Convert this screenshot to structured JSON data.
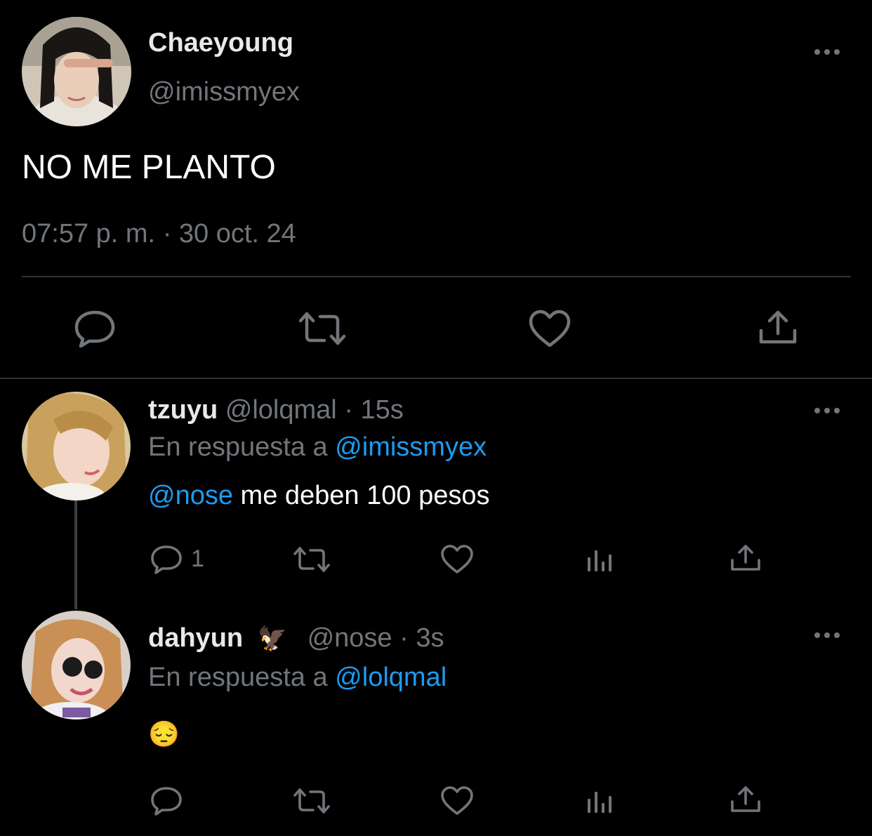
{
  "main_tweet": {
    "display_name": "Chaeyoung",
    "handle": "@imissmyex",
    "text": "NO ME PLANTO",
    "time": "07:57 p. m.",
    "separator": "·",
    "date": "30 oct. 24"
  },
  "replies": [
    {
      "display_name": "tzuyu",
      "handle": "@lolqmal",
      "separator": "·",
      "age": "15s",
      "reply_prefix": "En respuesta a",
      "reply_to": "@imissmyex",
      "mention": "@nose",
      "text": " me deben 100 pesos",
      "reply_count": "1"
    },
    {
      "display_name": "dahyun",
      "name_emoji": "🦅",
      "handle": "@nose",
      "separator": "·",
      "age": "3s",
      "reply_prefix": "En respuesta a",
      "reply_to": "@lolqmal",
      "text": "😔"
    }
  ],
  "icons": [
    "reply-icon",
    "retweet-icon",
    "like-icon",
    "views-icon",
    "share-icon",
    "more-icon"
  ],
  "colors": {
    "background": "#000000",
    "primary_text": "#e7e9ea",
    "secondary_text": "#71767b",
    "accent": "#1d9bf0",
    "divider": "#2f3336"
  }
}
